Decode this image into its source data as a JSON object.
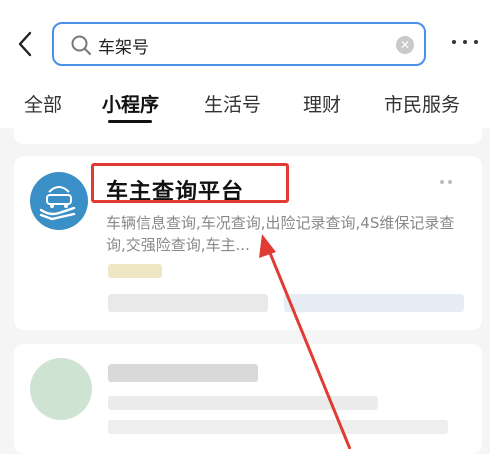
{
  "search": {
    "value": "车架号",
    "icon": "search-icon",
    "clear_icon": "clear-icon"
  },
  "tabs": [
    {
      "label": "全部",
      "active": false
    },
    {
      "label": "小程序",
      "active": true
    },
    {
      "label": "生活号",
      "active": false
    },
    {
      "label": "理财",
      "active": false
    },
    {
      "label": "市民服务",
      "active": false
    }
  ],
  "result": {
    "title": "车主查询平台",
    "description": "车辆信息查询,车况查询,出险记录查询,4S维保记录查询,交强险查询,车主..."
  },
  "colors": {
    "accent": "#4a8fe8",
    "highlight": "#e23b33",
    "avatar": "#3a8fc6"
  }
}
